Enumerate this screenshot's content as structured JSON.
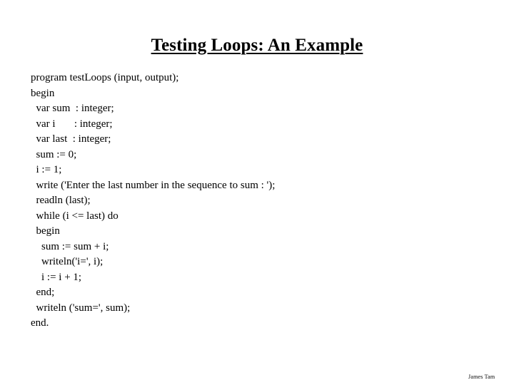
{
  "slide": {
    "title": "Testing Loops: An Example",
    "code_lines": [
      "program testLoops (input, output);",
      "begin",
      "  var sum  : integer;",
      "  var i       : integer;",
      "  var last  : integer;",
      "  sum := 0;",
      "  i := 1;",
      "  write ('Enter the last number in the sequence to sum : ');",
      "  readln (last);",
      "  while (i <= last) do",
      "  begin",
      "    sum := sum + i;",
      "    writeln('i=', i);",
      "    i := i + 1;",
      "  end;",
      "  writeln ('sum=', sum);",
      "end."
    ],
    "footer": {
      "author": "James Tam"
    }
  }
}
